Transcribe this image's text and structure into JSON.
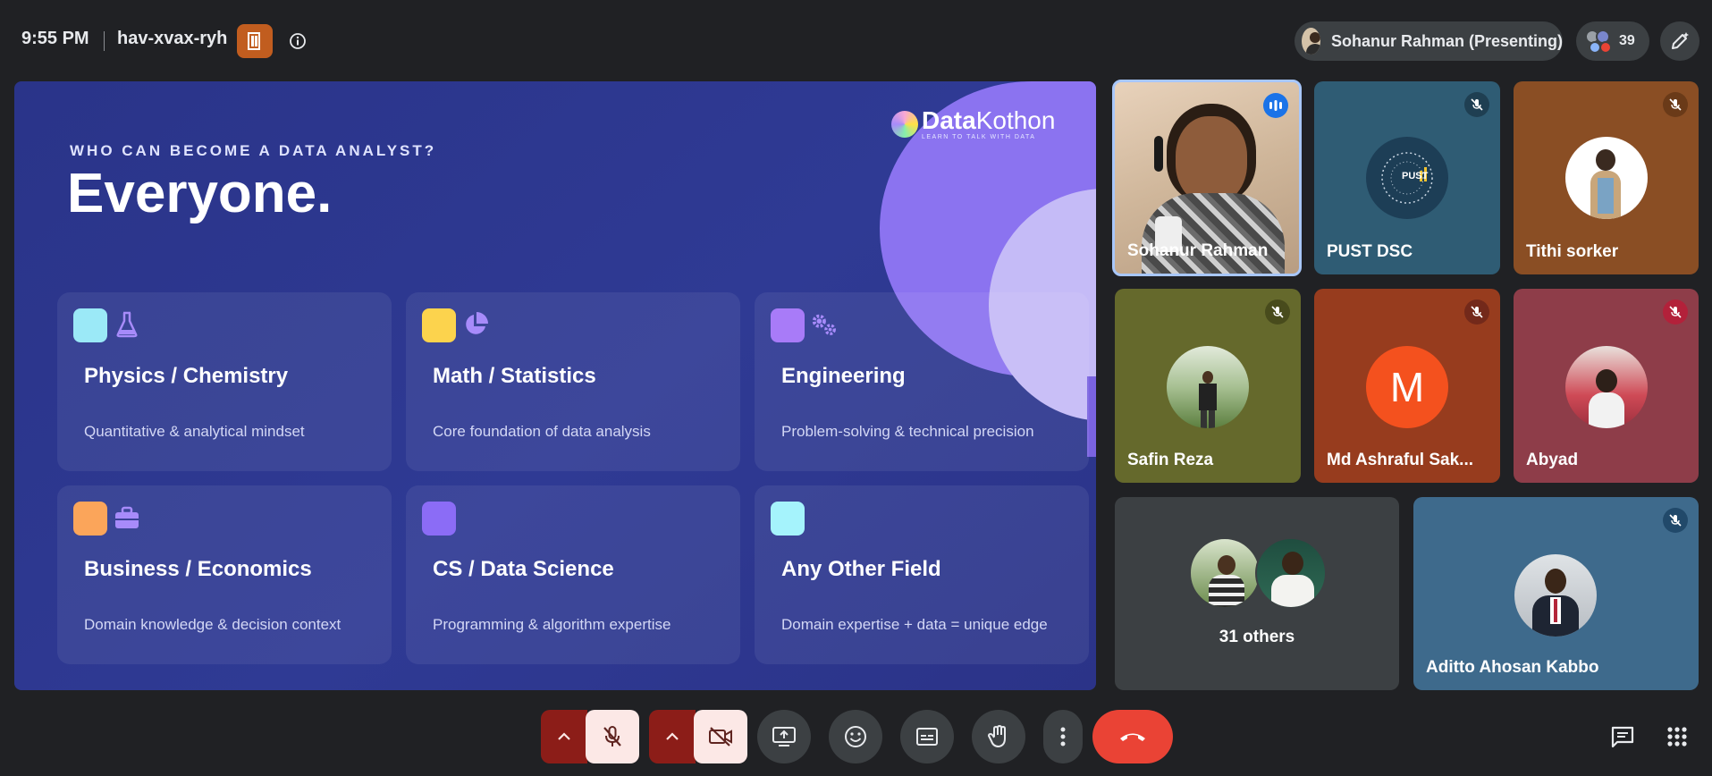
{
  "topbar": {
    "time": "9:55 PM",
    "meeting_code": "hav-xvax-ryh",
    "presenting_label": "Sohanur Rahman (Presenting)",
    "participant_count": "39"
  },
  "slide": {
    "brand_name_a": "Data",
    "brand_name_b": "Kothon",
    "brand_tagline": "LEARN TO TALK WITH DATA",
    "eyebrow": "WHO CAN BECOME A DATA ANALYST?",
    "headline": "Everyone.",
    "cards": [
      {
        "title": "Physics / Chemistry",
        "desc": "Quantitative & analytical mindset",
        "color": "#9be9f7",
        "icon": "flask-icon"
      },
      {
        "title": "Math / Statistics",
        "desc": "Core foundation of data analysis",
        "color": "#fcd34d",
        "icon": "pie-chart-icon"
      },
      {
        "title": "Engineering",
        "desc": "Problem-solving & technical precision",
        "color": "#a87bf8",
        "icon": "gears-icon"
      },
      {
        "title": "Business / Economics",
        "desc": "Domain knowledge & decision context",
        "color": "#fba55a",
        "icon": "briefcase-icon"
      },
      {
        "title": "CS / Data Science",
        "desc": "Programming & algorithm expertise",
        "color": "#8b6cf6",
        "icon": ""
      },
      {
        "title": "Any Other Field",
        "desc": "Domain expertise + data = unique edge",
        "color": "#a5f3fc",
        "icon": ""
      }
    ]
  },
  "participants": {
    "t1": "Sohanur Rahman",
    "t2": "PUST DSC",
    "t2_logo": "PUST",
    "t3": "Tithi sorker",
    "t4": "Safin Reza",
    "t5": "Md Ashraful Sak...",
    "t5_initial": "M",
    "t6": "Abyad",
    "others": "31 others",
    "t8": "Aditto Ahosan Kabbo"
  },
  "colors": {
    "end_call": "#ea4335",
    "muted_bg": "#8c1d18",
    "muted_fg": "#fce8e6",
    "host_badge": "#c15d1f"
  }
}
